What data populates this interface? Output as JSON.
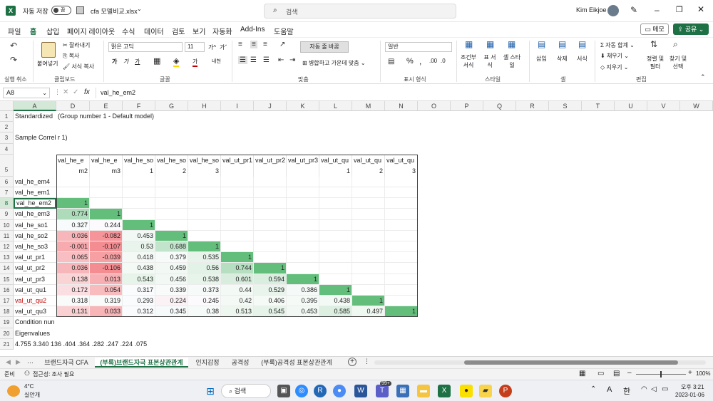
{
  "titlebar": {
    "autosave_label": "자동 저장",
    "autosave_state": "끔",
    "filename": "cfa 모델비교.xlsx",
    "search_placeholder": "검색",
    "user_name": "Kim Eikjoe"
  },
  "menu": [
    "파일",
    "홈",
    "삽입",
    "페이지 레이아웃",
    "수식",
    "데이터",
    "검토",
    "보기",
    "자동화",
    "Add-Ins",
    "도움말"
  ],
  "menu_active": "홈",
  "menu_right": {
    "memo": "메모",
    "share": "공유"
  },
  "ribbon": {
    "undo_label": "실행 취소",
    "clipboard": {
      "paste": "붙여넣기",
      "cut": "잘라내기",
      "copy": "복사",
      "format_painter": "서식 복사",
      "group": "클립보드"
    },
    "font": {
      "name": "맑은 고딕",
      "size": "11",
      "group": "글꼴",
      "bold": "가",
      "italic": "가",
      "underline": "가",
      "grow": "가^",
      "shrink": "가ˇ",
      "color_a": "가",
      "phonetic": "내천"
    },
    "align": {
      "wrap": "자동 줄 바꿈",
      "merge": "병합하고 가운데 맞춤",
      "group": "맞춤"
    },
    "number": {
      "format": "일반",
      "group": "표시 형식",
      "percent": "%",
      "comma": ","
    },
    "styles": {
      "cond": "조건부 서식",
      "table": "표 서식",
      "cell": "셀 스타일",
      "group": "스타일"
    },
    "cells": {
      "insert": "삽입",
      "delete": "삭제",
      "format": "서식",
      "group": "셀"
    },
    "edit": {
      "autosum": "자동 합계",
      "fill": "채우기",
      "clear": "지우기",
      "sort": "정렬 및 필터",
      "find": "찾기 및 선택",
      "group": "편집"
    }
  },
  "formula": {
    "namebox": "A8",
    "fx": "fx",
    "value": "val_he_em2"
  },
  "columns": [
    "A",
    "D",
    "E",
    "F",
    "G",
    "H",
    "I",
    "J",
    "K",
    "L",
    "M",
    "N",
    "O",
    "P",
    "Q",
    "R",
    "S",
    "T",
    "U",
    "V",
    "W"
  ],
  "rows": {
    "r1": "Standardized  (Group number 1 - Default model)",
    "r1a": "Standardized",
    "r1b": "(Group number 1 - Default model)",
    "r3a": "Sample Correl",
    "r3b": "r 1)",
    "headers": [
      [
        "val_he_e",
        "m2"
      ],
      [
        "val_he_e",
        "m3"
      ],
      [
        "val_he_so",
        "1"
      ],
      [
        "val_he_so",
        "2"
      ],
      [
        "val_he_so",
        "3"
      ],
      [
        "",
        "val_ut_pr1"
      ],
      [
        "",
        "val_ut_pr2"
      ],
      [
        "",
        "val_ut_pr3"
      ],
      [
        "val_ut_qu",
        "1"
      ],
      [
        "val_ut_qu",
        "2"
      ],
      [
        "val_ut_qu",
        "3"
      ]
    ],
    "row_labels": [
      "val_he_em4",
      "val_he_em1",
      "val_he_em2",
      "val_he_em3",
      "val_he_so1",
      "val_he_so2",
      "val_he_so3",
      "val_ut_pr1",
      "val_ut_pr2",
      "val_ut_pr3",
      "val_ut_qu1",
      "val_ut_qu2",
      "val_ut_qu3"
    ],
    "matrix": [
      [],
      [],
      [
        "1"
      ],
      [
        "0.774",
        "1"
      ],
      [
        "0.327",
        "0.244",
        "1"
      ],
      [
        "0.036",
        "-0.082",
        "0.453",
        "1"
      ],
      [
        "-0.001",
        "-0.107",
        "0.53",
        "0.688",
        "1"
      ],
      [
        "0.065",
        "-0.039",
        "0.418",
        "0.379",
        "0.535",
        "1"
      ],
      [
        "0.036",
        "-0.106",
        "0.438",
        "0.459",
        "0.56",
        "0.744",
        "1"
      ],
      [
        "0.138",
        "0.013",
        "0.543",
        "0.456",
        "0.538",
        "0.601",
        "0.594",
        "1"
      ],
      [
        "0.172",
        "0.054",
        "0.317",
        "0.339",
        "0.373",
        "0.44",
        "0.529",
        "0.386",
        "1"
      ],
      [
        "0.318",
        "0.319",
        "0.293",
        "0.224",
        "0.245",
        "0.42",
        "0.406",
        "0.395",
        "0.438",
        "1"
      ],
      [
        "0.131",
        "0.033",
        "0.312",
        "0.345",
        "0.38",
        "0.513",
        "0.545",
        "0.453",
        "0.585",
        "0.497",
        "1"
      ]
    ],
    "r19": "Condition nun",
    "r20": "Eigenvalues",
    "r21": "4.755 3.340 1.36 .404 .364 .282 .247 .224 .075",
    "r21_display": "4.755 3.340 136 .404 .364 .282 .247 .224 .075"
  },
  "sheets": [
    "브랜드자극 CFA",
    "(부록)브랜드자극 표본상관관계",
    "인지감정",
    "공격성",
    "(부록)공격성 표본상관관계"
  ],
  "active_sheet": "(부록)브랜드자극 표본상관관계",
  "status": {
    "ready": "준비",
    "accessibility": "접근성: 조사 필요",
    "zoom": "100%"
  },
  "taskbar": {
    "weather_temp": "4°C",
    "weather_desc": "실안개",
    "search": "검색",
    "time": "오후 3:21",
    "date": "2023-01-06",
    "lang": "A",
    "ime": "한",
    "badge": "99+"
  },
  "colors": {
    "excel_green": "#1e7145",
    "red_text": "#c00000"
  }
}
